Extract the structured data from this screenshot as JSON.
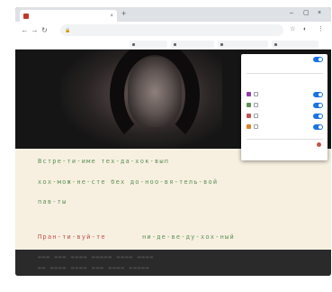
{
  "browser": {
    "tab_title": "",
    "tab_close": "×",
    "new_tab": "+",
    "window_controls": [
      "–",
      "▢",
      "×"
    ],
    "nav": [
      "←",
      "→",
      "↻"
    ],
    "lock_icon": "🔒",
    "url": "",
    "toolbar_icons": [
      "☆",
      "◐",
      "⋮"
    ],
    "bookmarks": [
      "",
      "",
      "",
      ""
    ]
  },
  "popup": {
    "title": "",
    "subtitle": "",
    "section_title": "",
    "section_subtitle": "",
    "colors": [
      {
        "color": "#8e3fa3",
        "label": ""
      },
      {
        "color": "#5e9155",
        "label": ""
      },
      {
        "color": "#c2534d",
        "label": ""
      },
      {
        "color": "#d9822b",
        "label": ""
      }
    ],
    "footer_label": ""
  },
  "subtitles": {
    "line1": "Встре-ти-име тех-да-хок-вып",
    "line2": "хох-мож-не-сте  бех до-ноо-вя-тель-вой",
    "line3": "пав-ты",
    "line4_red": "Пран-ти-вуй-те",
    "line4_green": "ни-де-ве-ду-хох-ный"
  }
}
